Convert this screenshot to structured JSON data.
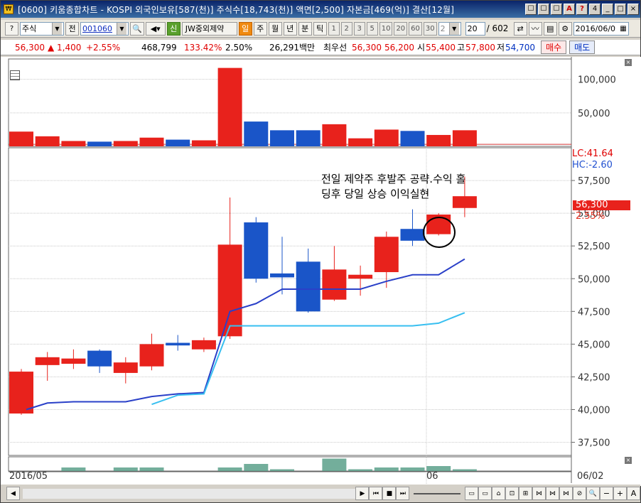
{
  "title": "[0600] 키움종합차트 - KOSPI 외국인보유[587(천)] 주식수[18,743(천)] 액면[2,500] 자본금[469(억)] 결산[12월]",
  "title_buttons": [
    "☐",
    "☐",
    "☐",
    "A",
    "?",
    "4"
  ],
  "toolbar": {
    "market": "주식",
    "prev_label": "전",
    "code": "001060",
    "new_label": "신",
    "stock_name": "JW중외제약",
    "period_buttons": [
      "일",
      "주",
      "월",
      "년",
      "분",
      "틱"
    ],
    "active_period": "일",
    "interval_buttons": [
      "1",
      "2",
      "3",
      "5",
      "10",
      "20",
      "60",
      "30"
    ],
    "interval_select": "2",
    "count": "20",
    "total": "/ 602",
    "date": "2016/06/0"
  },
  "quote": {
    "price": "56,300",
    "change": "▲ 1,400",
    "change_pct": "+2.55%",
    "volume": "468,799",
    "volume_ratio": "133.42%",
    "turnover": "2.50%",
    "amount": "26,291백만",
    "ask_label": "최우선",
    "ask": "56,300",
    "bid": "56,200",
    "open_label": "시",
    "open": "55,400",
    "high_label": "고",
    "high": "57,800",
    "low_label": "저",
    "low": "54,700",
    "buy_label": "매수",
    "sell_label": "매도"
  },
  "indicators": {
    "lc": "LC:41.64",
    "hc": "HC:-2.60",
    "price_tag": "56,300",
    "pct_tag": "2.55%"
  },
  "annotation": {
    "line1": "전일 제약주 후발주 공략.수익 홀",
    "line2": "딩후 당일 상승 이익실현"
  },
  "x_labels": {
    "start": "2016/05",
    "mid": "06",
    "right": "06/02"
  },
  "chart_data": {
    "type": "candlestick",
    "candles": [
      {
        "o": 39700,
        "h": 43100,
        "l": 39600,
        "c": 42900,
        "color": "red"
      },
      {
        "o": 43400,
        "h": 44400,
        "l": 42200,
        "c": 44000,
        "color": "red"
      },
      {
        "o": 43500,
        "h": 44600,
        "l": 43100,
        "c": 43900,
        "color": "red"
      },
      {
        "o": 44500,
        "h": 44600,
        "l": 42800,
        "c": 43300,
        "color": "blue"
      },
      {
        "o": 42800,
        "h": 44000,
        "l": 42000,
        "c": 43600,
        "color": "red"
      },
      {
        "o": 43300,
        "h": 45800,
        "l": 43000,
        "c": 45000,
        "color": "red"
      },
      {
        "o": 45100,
        "h": 45700,
        "l": 44500,
        "c": 44900,
        "color": "blue"
      },
      {
        "o": 44600,
        "h": 45500,
        "l": 44400,
        "c": 45300,
        "color": "red"
      },
      {
        "o": 45600,
        "h": 56200,
        "l": 45400,
        "c": 52600,
        "color": "red"
      },
      {
        "o": 54300,
        "h": 54700,
        "l": 49700,
        "c": 50000,
        "color": "blue"
      },
      {
        "o": 50400,
        "h": 53200,
        "l": 48800,
        "c": 50100,
        "color": "blue"
      },
      {
        "o": 51300,
        "h": 52300,
        "l": 47400,
        "c": 47500,
        "color": "blue"
      },
      {
        "o": 48400,
        "h": 52500,
        "l": 48300,
        "c": 50700,
        "color": "red"
      },
      {
        "o": 50000,
        "h": 51000,
        "l": 48700,
        "c": 50300,
        "color": "red"
      },
      {
        "o": 50500,
        "h": 53600,
        "l": 49300,
        "c": 53200,
        "color": "red"
      },
      {
        "o": 53800,
        "h": 55300,
        "l": 52500,
        "c": 52900,
        "color": "blue"
      },
      {
        "o": 53400,
        "h": 55000,
        "l": 53300,
        "c": 54900,
        "color": "red"
      },
      {
        "o": 55400,
        "h": 57800,
        "l": 54700,
        "c": 56300,
        "color": "red"
      }
    ],
    "ma_short": [
      40000,
      40500,
      40600,
      40600,
      40600,
      41000,
      41200,
      41300,
      47500,
      48100,
      49200,
      49200,
      49200,
      49200,
      49800,
      50300,
      50300,
      51500
    ],
    "ma_long": [
      null,
      null,
      null,
      null,
      null,
      40400,
      41100,
      41200,
      46400,
      46400,
      46400,
      46400,
      46400,
      46400,
      46400,
      46400,
      46600,
      47400
    ],
    "volumes": [
      {
        "v": 22000,
        "color": "red"
      },
      {
        "v": 15000,
        "color": "red"
      },
      {
        "v": 8000,
        "color": "red"
      },
      {
        "v": 7000,
        "color": "blue"
      },
      {
        "v": 8000,
        "color": "red"
      },
      {
        "v": 13000,
        "color": "red"
      },
      {
        "v": 10000,
        "color": "blue"
      },
      {
        "v": 9000,
        "color": "red"
      },
      {
        "v": 117000,
        "color": "red"
      },
      {
        "v": 37000,
        "color": "blue"
      },
      {
        "v": 24000,
        "color": "blue"
      },
      {
        "v": 24000,
        "color": "blue"
      },
      {
        "v": 33000,
        "color": "red"
      },
      {
        "v": 12000,
        "color": "red"
      },
      {
        "v": 25000,
        "color": "red"
      },
      {
        "v": 23000,
        "color": "blue"
      },
      {
        "v": 17000,
        "color": "red"
      },
      {
        "v": 24000,
        "color": "red"
      }
    ],
    "indicator_bars": [
      0,
      0,
      1,
      0,
      1,
      1,
      0,
      0,
      1,
      2,
      0.5,
      0,
      3.5,
      0.5,
      1,
      1,
      1.4,
      0.5
    ],
    "price_ticks": [
      "57,500",
      "55,000",
      "52,500",
      "50,000",
      "47,500",
      "45,000",
      "42,500",
      "40,000",
      "37,500"
    ],
    "price_tick_values": [
      57500,
      55000,
      52500,
      50000,
      47500,
      45000,
      42500,
      40000,
      37500
    ],
    "volume_ticks": [
      "100,000",
      "50,000"
    ],
    "volume_tick_values": [
      100000,
      50000
    ],
    "ylim": [
      36500,
      60000
    ],
    "colors": {
      "up": "#e8221c",
      "down": "#1a55c8",
      "ma_short": "#2a40c8",
      "ma_long": "#38bff0"
    }
  }
}
